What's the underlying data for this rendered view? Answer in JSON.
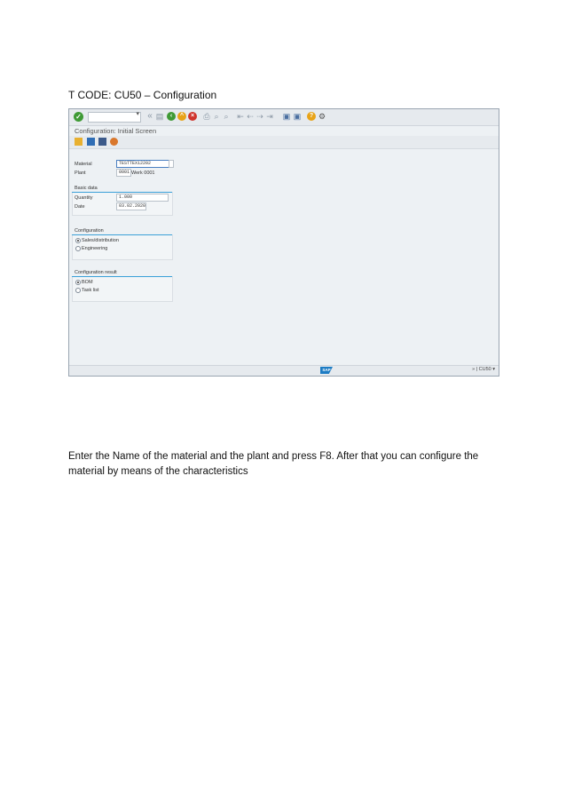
{
  "heading": "T CODE: CU50 – Configuration",
  "paragraph": "Enter the Name of the material and the plant and press F8. After that you can configure the material by means of the characteristics",
  "sap": {
    "screen_title": "Configuration: Initial Screen",
    "fields": {
      "material_label": "Material",
      "material_value": "TESTTEX12202",
      "plant_label": "Plant",
      "plant_value": "0001",
      "plant_desc": "Werk 0001"
    },
    "basic_data": {
      "title": "Basic data",
      "quantity_label": "Quantity",
      "quantity_value": "1.000",
      "date_label": "Date",
      "date_value": "03.02.2020"
    },
    "configuration": {
      "title": "Configuration",
      "options": [
        "Sales/distribution",
        "Engineering"
      ],
      "selected": 0
    },
    "configuration_result": {
      "title": "Configuration result",
      "options": [
        "BOM",
        "Task list"
      ],
      "selected": 0
    },
    "status": {
      "logo": "SAP",
      "tcode": "CU50",
      "prefix": "»"
    },
    "colors": {
      "accent": "#3aa0d8",
      "ok": "#3f9a35",
      "back": "#3f9a35",
      "exit": "#e8a317",
      "cancel": "#d0342c",
      "help": "#e8a317"
    }
  }
}
